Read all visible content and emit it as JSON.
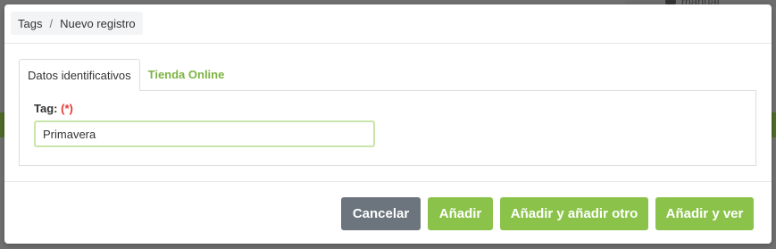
{
  "background": {
    "user_label": "manual"
  },
  "breadcrumb": {
    "items": [
      "Tags",
      "Nuevo registro"
    ],
    "separator": "/"
  },
  "tabs": [
    {
      "label": "Datos identificativos",
      "active": true
    },
    {
      "label": "Tienda Online",
      "active": false
    }
  ],
  "form": {
    "tag_label": "Tag:",
    "required_marker": "(*)",
    "tag_value": "Primavera"
  },
  "footer": {
    "cancel_label": "Cancelar",
    "add_label": "Añadir",
    "add_another_label": "Añadir y añadir otro",
    "add_view_label": "Añadir y ver"
  },
  "colors": {
    "accent_green": "#8bc34a",
    "tab_green": "#7cb342",
    "cancel_gray": "#6c757d",
    "required_red": "#e53935"
  }
}
